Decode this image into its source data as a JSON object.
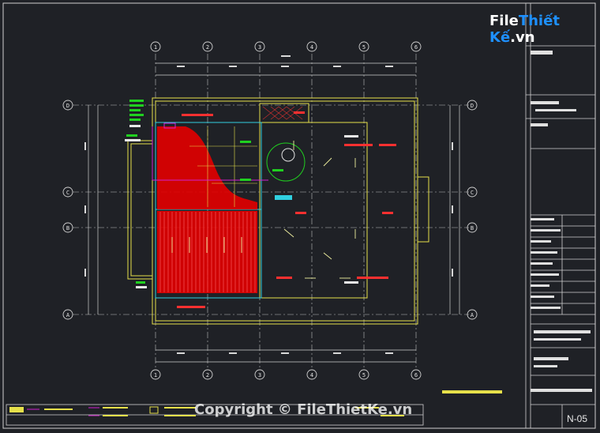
{
  "watermark": {
    "logo_part1": "File",
    "logo_part2": "Thiết Kế",
    "logo_part3": ".vn",
    "copyright": "Copyright © FileThietKe.vn"
  },
  "title_block": {
    "sheet_number": "N-05"
  },
  "grid": {
    "columns": [
      "1",
      "2",
      "3",
      "4",
      "5",
      "6"
    ],
    "rows": [
      "D",
      "C",
      "B",
      "A"
    ]
  },
  "colors": {
    "background": "#1f2126",
    "wall": "#e6e04a",
    "roof_fill": "#e00000",
    "grid_line": "#cfcfcf",
    "annotation": "#ff3030",
    "label_green": "#20d020",
    "cyan": "#30d0e0",
    "magenta": "#d020d0"
  }
}
